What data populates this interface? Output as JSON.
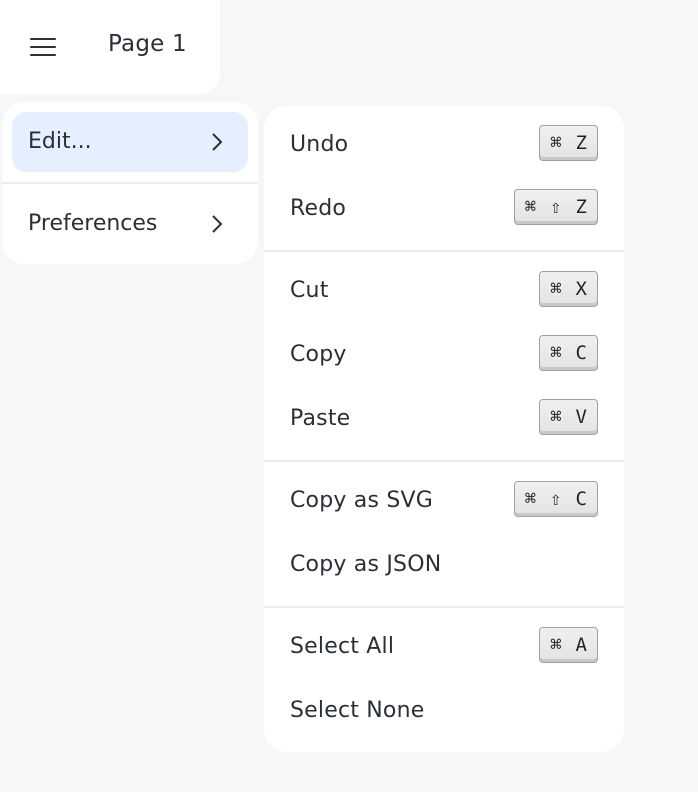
{
  "header": {
    "page_title": "Page 1",
    "menu_icon": "hamburger-menu-icon"
  },
  "main_menu": {
    "items": [
      {
        "label": "Edit...",
        "active": true,
        "icon": "chevron-right-icon"
      },
      {
        "label": "Preferences",
        "active": false,
        "icon": "chevron-right-icon"
      }
    ]
  },
  "edit_submenu": {
    "groups": [
      {
        "items": [
          {
            "label": "Undo",
            "shortcut": [
              "⌘",
              "Z"
            ]
          },
          {
            "label": "Redo",
            "shortcut": [
              "⌘",
              "⇧",
              "Z"
            ]
          }
        ]
      },
      {
        "items": [
          {
            "label": "Cut",
            "shortcut": [
              "⌘",
              "X"
            ]
          },
          {
            "label": "Copy",
            "shortcut": [
              "⌘",
              "C"
            ]
          },
          {
            "label": "Paste",
            "shortcut": [
              "⌘",
              "V"
            ]
          }
        ]
      },
      {
        "items": [
          {
            "label": "Copy as SVG",
            "shortcut": [
              "⌘",
              "⇧",
              "C"
            ]
          },
          {
            "label": "Copy as JSON",
            "shortcut": []
          }
        ]
      },
      {
        "items": [
          {
            "label": "Select All",
            "shortcut": [
              "⌘",
              "A"
            ]
          },
          {
            "label": "Select None",
            "shortcut": []
          }
        ]
      }
    ]
  },
  "colors": {
    "background": "#f6f7f9",
    "panel": "#ffffff",
    "active_item": "#e6efff",
    "divider": "#e7eef8",
    "text": "#2b2f36"
  }
}
